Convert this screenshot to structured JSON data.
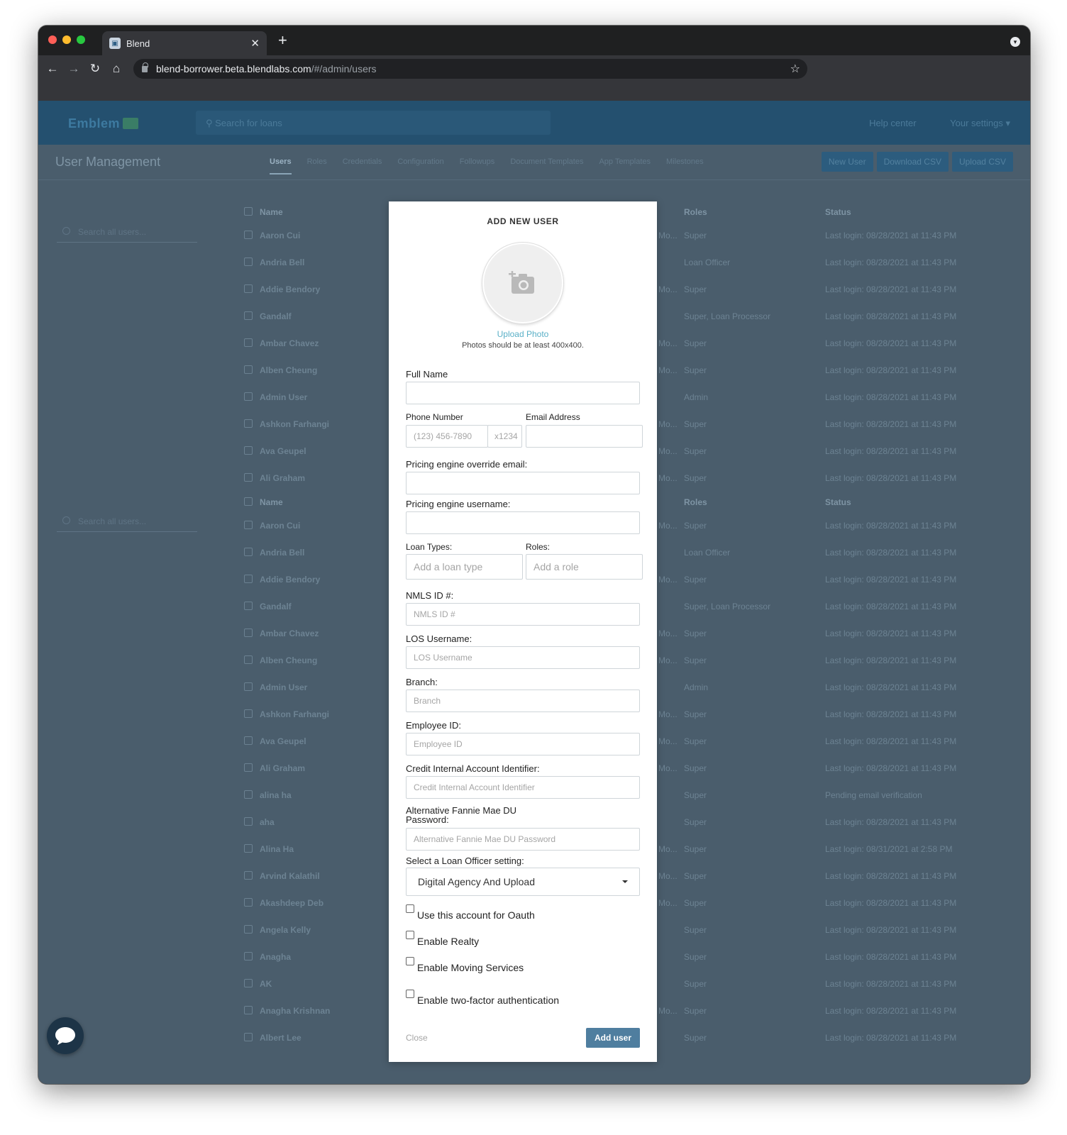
{
  "browser": {
    "tab_title": "Blend",
    "url_host": "blend-borrower.beta.blendlabs.com",
    "url_path": "/#/admin/users",
    "colors": {
      "close": "#ff5f57",
      "minimize": "#febc2e",
      "maximize": "#28c840"
    }
  },
  "app": {
    "logo": "Emblem",
    "search_placeholder": "Search for loans",
    "help_center": "Help center",
    "your_settings": "Your settings",
    "page_title": "User Management",
    "tabs": [
      "Users",
      "Roles",
      "Credentials",
      "Configuration",
      "Followups",
      "Document Templates",
      "App Templates",
      "Milestones"
    ],
    "buttons": [
      "New User",
      "Download CSV",
      "Upload CSV"
    ],
    "sidebar_search_placeholder": "Search all users...",
    "columns": {
      "name": "Name",
      "roles": "Roles",
      "status": "Status"
    },
    "rows_top": [
      {
        "name": "Aaron Cui",
        "mid": "Mo...",
        "role": "Super",
        "status": "Last login: 08/28/2021 at 11:43 PM"
      },
      {
        "name": "Andria Bell",
        "mid": "",
        "role": "Loan Officer",
        "status": "Last login: 08/28/2021 at 11:43 PM"
      },
      {
        "name": "Addie Bendory",
        "mid": "Mo...",
        "role": "Super",
        "status": "Last login: 08/28/2021 at 11:43 PM"
      },
      {
        "name": "Gandalf",
        "mid": "",
        "role": "Super, Loan Processor",
        "status": "Last login: 08/28/2021 at 11:43 PM"
      },
      {
        "name": "Ambar Chavez",
        "mid": "Mo...",
        "role": "Super",
        "status": "Last login: 08/28/2021 at 11:43 PM"
      },
      {
        "name": "Alben Cheung",
        "mid": "Mo...",
        "role": "Super",
        "status": "Last login: 08/28/2021 at 11:43 PM"
      },
      {
        "name": "Admin User",
        "mid": "",
        "role": "Admin",
        "status": "Last login: 08/28/2021 at 11:43 PM"
      },
      {
        "name": "Ashkon Farhangi",
        "mid": "Mo...",
        "role": "Super",
        "status": "Last login: 08/28/2021 at 11:43 PM"
      },
      {
        "name": "Ava Geupel",
        "mid": "Mo...",
        "role": "Super",
        "status": "Last login: 08/28/2021 at 11:43 PM"
      },
      {
        "name": "Ali Graham",
        "mid": "Mo...",
        "role": "Super",
        "status": "Last login: 08/28/2021 at 11:43 PM"
      }
    ],
    "rows_bottom": [
      {
        "name": "Aaron Cui",
        "mid": "Mo...",
        "role": "Super",
        "status": "Last login: 08/28/2021 at 11:43 PM"
      },
      {
        "name": "Andria Bell",
        "mid": "",
        "role": "Loan Officer",
        "status": "Last login: 08/28/2021 at 11:43 PM"
      },
      {
        "name": "Addie Bendory",
        "mid": "Mo...",
        "role": "Super",
        "status": "Last login: 08/28/2021 at 11:43 PM"
      },
      {
        "name": "Gandalf",
        "mid": "",
        "role": "Super, Loan Processor",
        "status": "Last login: 08/28/2021 at 11:43 PM"
      },
      {
        "name": "Ambar Chavez",
        "mid": "Mo...",
        "role": "Super",
        "status": "Last login: 08/28/2021 at 11:43 PM"
      },
      {
        "name": "Alben Cheung",
        "mid": "Mo...",
        "role": "Super",
        "status": "Last login: 08/28/2021 at 11:43 PM"
      },
      {
        "name": "Admin User",
        "mid": "",
        "role": "Admin",
        "status": "Last login: 08/28/2021 at 11:43 PM"
      },
      {
        "name": "Ashkon Farhangi",
        "mid": "Mo...",
        "role": "Super",
        "status": "Last login: 08/28/2021 at 11:43 PM"
      },
      {
        "name": "Ava Geupel",
        "mid": "Mo...",
        "role": "Super",
        "status": "Last login: 08/28/2021 at 11:43 PM"
      },
      {
        "name": "Ali Graham",
        "mid": "Mo...",
        "role": "Super",
        "status": "Last login: 08/28/2021 at 11:43 PM"
      },
      {
        "name": "alina ha",
        "mid": "",
        "role": "Super",
        "status": "Pending email verification"
      },
      {
        "name": "aha",
        "mid": "",
        "role": "Super",
        "status": "Last login: 08/28/2021 at 11:43 PM"
      },
      {
        "name": "Alina Ha",
        "mid": "Mo...",
        "role": "Super",
        "status": "Last login: 08/31/2021 at 2:58 PM"
      },
      {
        "name": "Arvind Kalathil",
        "mid": "Mo...",
        "role": "Super",
        "status": "Last login: 08/28/2021 at 11:43 PM"
      },
      {
        "name": "Akashdeep Deb",
        "mid": "Mo...",
        "role": "Super",
        "status": "Last login: 08/28/2021 at 11:43 PM"
      },
      {
        "name": "Angela Kelly",
        "mid": "",
        "role": "Super",
        "status": "Last login: 08/28/2021 at 11:43 PM"
      },
      {
        "name": "Anagha",
        "mid": "",
        "role": "Super",
        "status": "Last login: 08/28/2021 at 11:43 PM"
      },
      {
        "name": "AK",
        "mid": "",
        "role": "Super",
        "status": "Last login: 08/28/2021 at 11:43 PM"
      },
      {
        "name": "Anagha Krishnan",
        "mid": "Mo...",
        "role": "Super",
        "status": "Last login: 08/28/2021 at 11:43 PM"
      },
      {
        "name": "Albert Lee",
        "mid": "",
        "role": "Super",
        "status": "Last login: 08/28/2021 at 11:43 PM"
      }
    ]
  },
  "modal": {
    "title": "ADD NEW USER",
    "upload_photo": "Upload Photo",
    "photo_hint": "Photos should be at least 400x400.",
    "full_name_label": "Full Name",
    "full_name_value": "",
    "phone_label": "Phone Number",
    "phone_placeholder": "(123) 456-7890",
    "ext_placeholder": "x1234",
    "email_label": "Email Address",
    "pricing_email_label": "Pricing engine override email:",
    "pricing_username_label": "Pricing engine username:",
    "loan_types_label": "Loan Types:",
    "loan_types_placeholder": "Add a loan type",
    "roles_label": "Roles:",
    "roles_placeholder": "Add a role",
    "nmls_label": "NMLS ID #:",
    "nmls_placeholder": "NMLS ID #",
    "los_label": "LOS Username:",
    "los_placeholder": "LOS Username",
    "branch_label": "Branch:",
    "branch_placeholder": "Branch",
    "employee_label": "Employee ID:",
    "employee_placeholder": "Employee ID",
    "credit_label": "Credit Internal Account Identifier:",
    "credit_placeholder": "Credit Internal Account Identifier",
    "fannie_label_line1": "Alternative Fannie Mae DU",
    "fannie_label_line2": "Password:",
    "fannie_placeholder": "Alternative Fannie Mae DU Password",
    "loan_officer_label": "Select a Loan Officer setting:",
    "loan_officer_value": "Digital Agency And Upload",
    "checkboxes": [
      "Use this account for Oauth",
      "Enable Realty",
      "Enable Moving Services",
      "Enable two-factor authentication"
    ],
    "close": "Close",
    "add_user": "Add user"
  }
}
